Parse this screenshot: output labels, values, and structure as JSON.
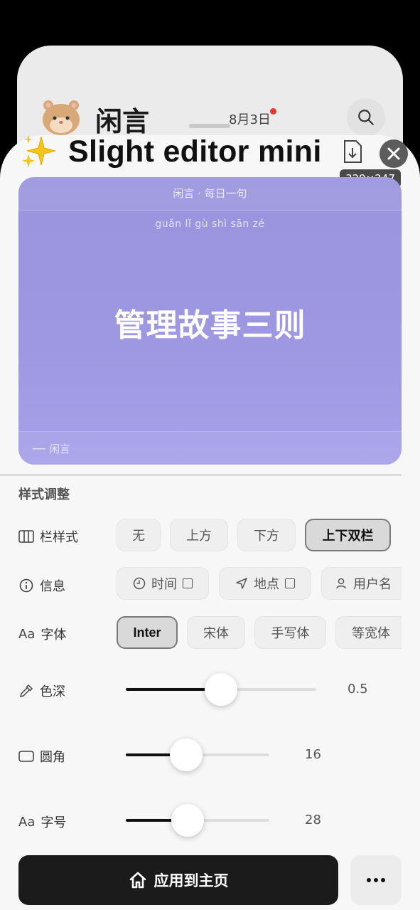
{
  "background_app": {
    "title": "闲言",
    "date": "8月3日"
  },
  "sheet": {
    "title": "Slight editor mini",
    "dimensions": "329×247"
  },
  "preview": {
    "top_caption": "闲言 · 每日一句",
    "pinyin": "guǎn lǐ gù shì sān zé",
    "main_text": "管理故事三则",
    "signature": "── 闲言",
    "gradient_color": "#9e98e2"
  },
  "style_section": {
    "title": "样式调整",
    "bar_style": {
      "label": "栏样式",
      "options": [
        "无",
        "上方",
        "下方",
        "上下双栏"
      ],
      "selected": "上下双栏"
    },
    "info": {
      "label": "信息",
      "options": [
        "时间",
        "地点",
        "用户名"
      ]
    },
    "font": {
      "label": "字体",
      "options": [
        "Inter",
        "宋体",
        "手写体",
        "等宽体"
      ],
      "selected": "Inter"
    },
    "color_depth": {
      "label": "色深",
      "value": "0.5",
      "fraction": 0.5
    },
    "radius": {
      "label": "圆角",
      "value": "16",
      "fraction": 0.42
    },
    "font_size": {
      "label": "字号",
      "value": "28",
      "fraction": 0.43
    }
  },
  "actions": {
    "apply_label": "应用到主页"
  }
}
